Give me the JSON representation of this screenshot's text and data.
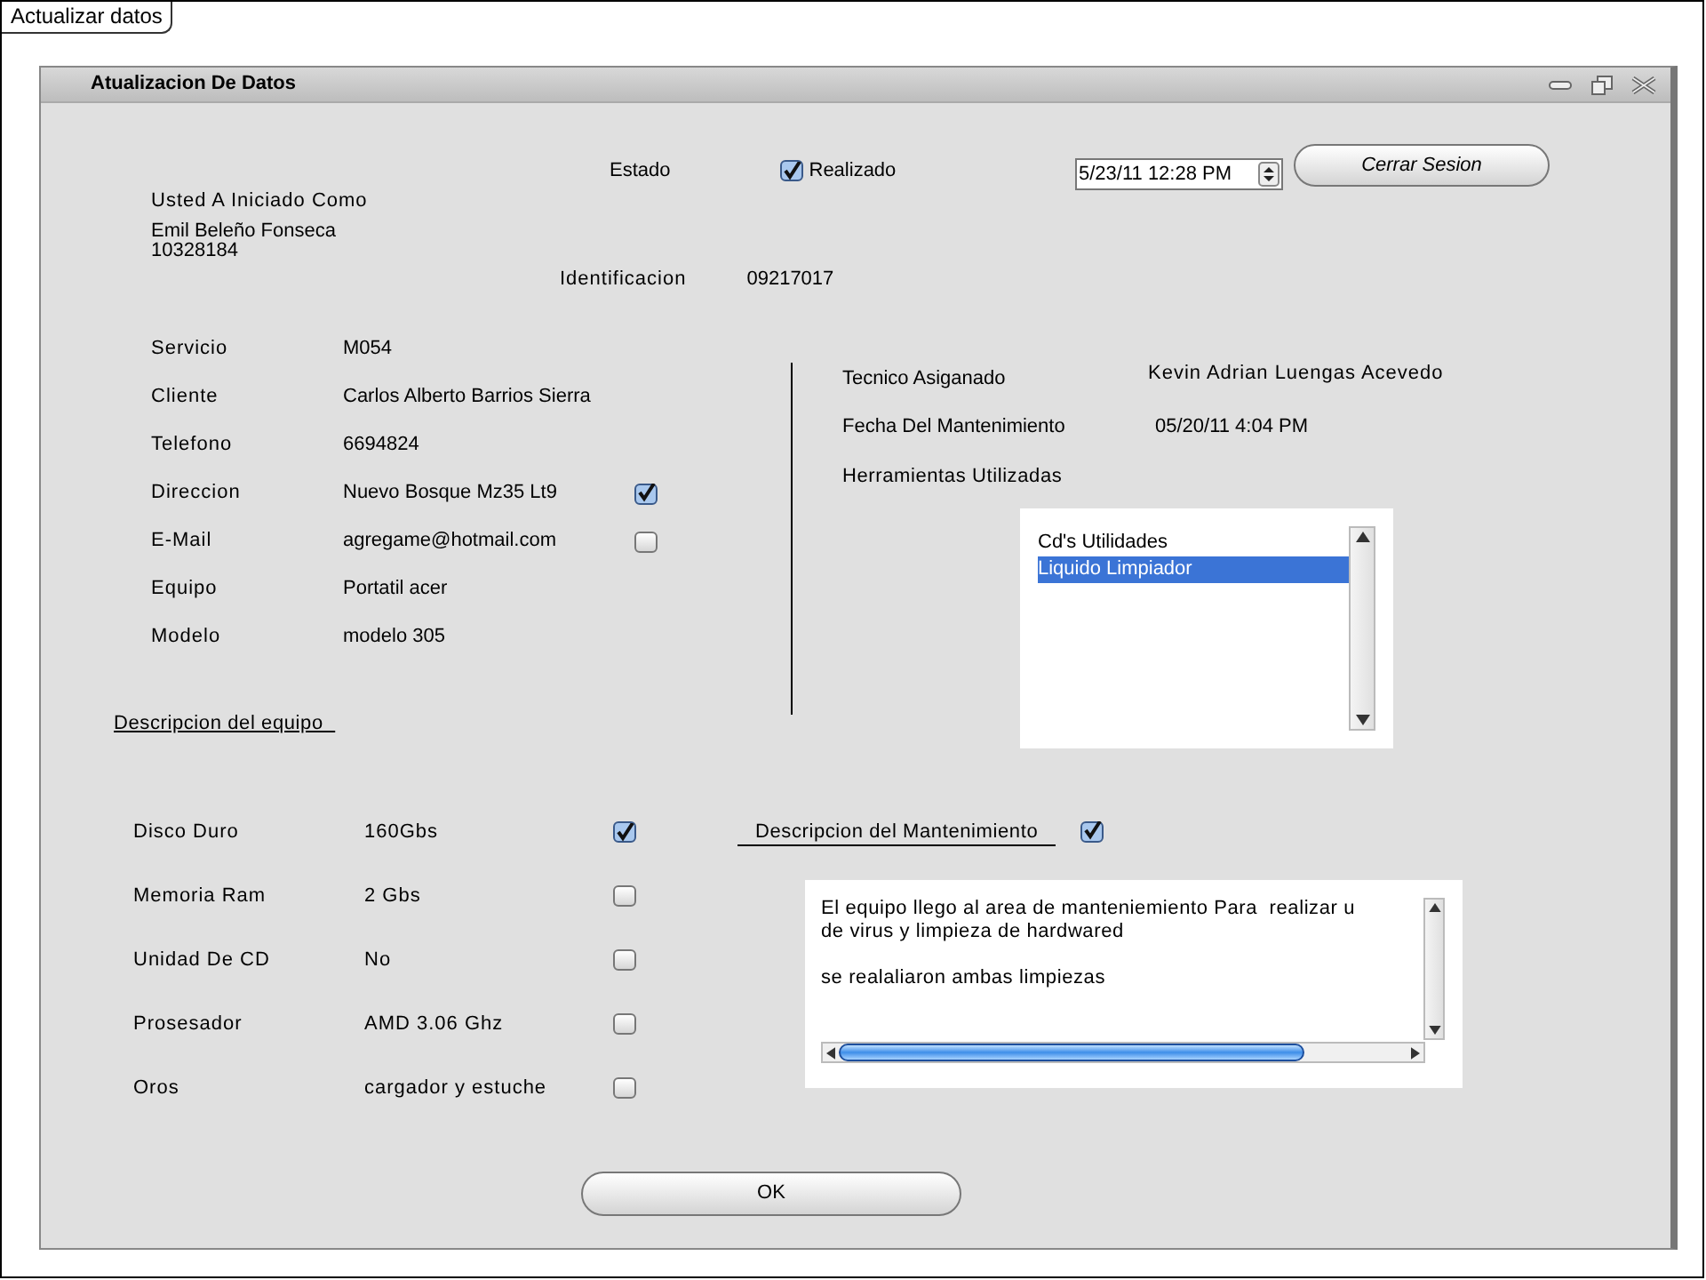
{
  "tab": {
    "label": "Actualizar datos"
  },
  "window": {
    "title": "Atualizacion De Datos"
  },
  "session": {
    "caption": "Usted A Iniciado Como",
    "user": "Emil Beleño Fonseca",
    "user_id": "10328184"
  },
  "status": {
    "label": "Estado",
    "option": "Realizado",
    "checked": true
  },
  "datetime": {
    "value": "5/23/11 12:28 PM"
  },
  "logout_button": "Cerrar Sesion",
  "identification": {
    "label": "Identificacion",
    "value": "09217017"
  },
  "client_fields": [
    {
      "kind": "text",
      "label": "Servicio",
      "value": "M054"
    },
    {
      "kind": "text",
      "label": "Cliente",
      "value": "Carlos Alberto Barrios Sierra"
    },
    {
      "kind": "text",
      "label": "Telefono",
      "value": "6694824"
    },
    {
      "kind": "checkbox",
      "label": "Direccion",
      "value": "Nuevo Bosque Mz35 Lt9",
      "checked": true
    },
    {
      "kind": "checkbox",
      "label": "E-Mail",
      "value": "agregame@hotmail.com",
      "checked": false
    },
    {
      "kind": "text",
      "label": "Equipo",
      "value": "Portatil acer"
    },
    {
      "kind": "text",
      "label": "Modelo",
      "value": "modelo 305"
    }
  ],
  "technician": {
    "label": "Tecnico Asiganado",
    "value": "Kevin Adrian Luengas Acevedo"
  },
  "maintenance_date": {
    "label": "Fecha Del Mantenimiento",
    "value": "05/20/11 4:04 PM"
  },
  "tools": {
    "label": "Herramientas Utilizadas",
    "items": [
      {
        "label": "Cd's Utilidades",
        "selected": false
      },
      {
        "label": "Liquido Limpiador",
        "selected": true
      }
    ]
  },
  "equipment_heading": "Descripcion del equipo",
  "equipment": [
    {
      "label": "Disco Duro",
      "value": "160Gbs",
      "checked": true
    },
    {
      "label": "Memoria Ram",
      "value": "2 Gbs",
      "checked": false
    },
    {
      "label": "Unidad De CD",
      "value": "No",
      "checked": false
    },
    {
      "label": "Prosesador",
      "value": "AMD 3.06 Ghz",
      "checked": false
    },
    {
      "label": "Oros",
      "value": "cargador y estuche",
      "checked": false
    }
  ],
  "maintenance_description": {
    "label": "Descripcion del Mantenimiento",
    "checked": true,
    "paragraphs": [
      "El equipo llego al area de manteniemiento Para  realizar u",
      "de virus y limpieza de hardwared",
      "se realaliaron ambas limpiezas"
    ]
  },
  "ok_button": "OK"
}
